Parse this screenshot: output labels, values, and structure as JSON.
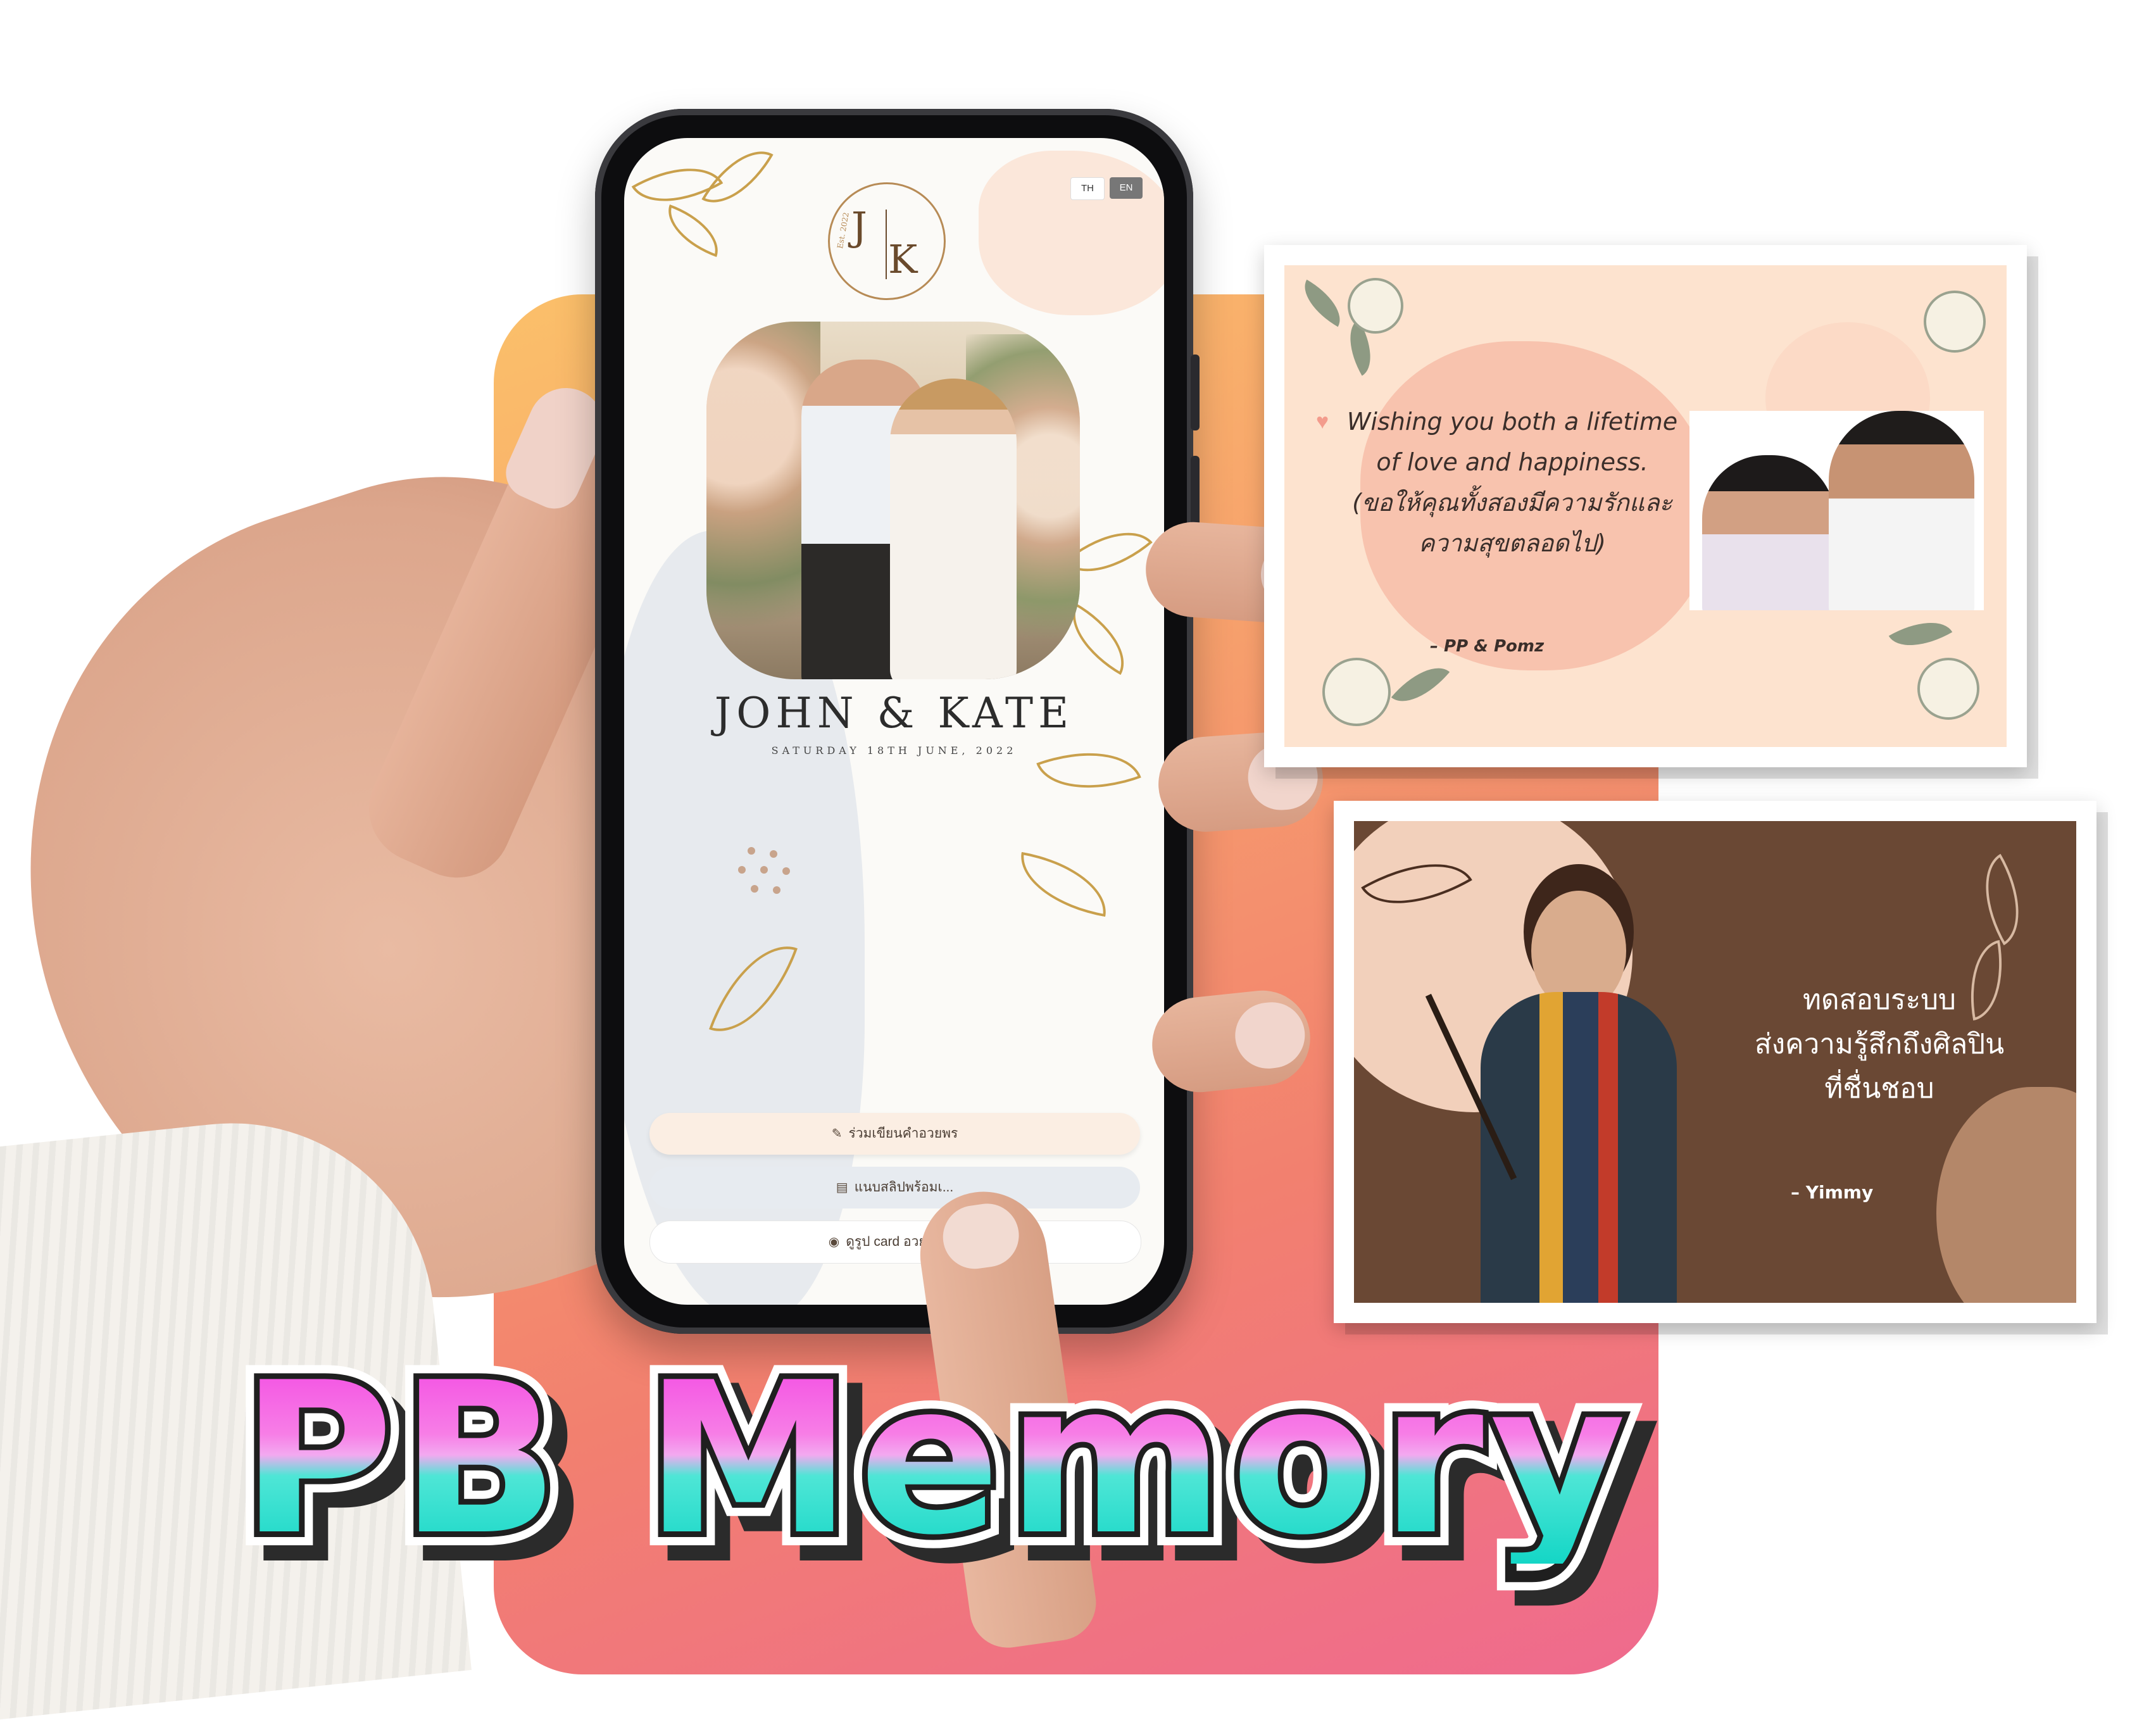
{
  "phone": {
    "lang_th": "TH",
    "lang_en": "EN",
    "monogram_j": "J",
    "monogram_k": "K",
    "monogram_est": "Est. 2022",
    "couple_names": "JOHN & KATE",
    "wedding_date": "SATURDAY 18TH JUNE, 2022",
    "buttons": [
      {
        "label": "ร่วมเขียนคำอวยพร",
        "icon": "pen-icon"
      },
      {
        "label": "แนบสลิปพร้อมเ...",
        "icon": "receipt-icon"
      },
      {
        "label": "ดูรูป card อวยพรทั้...",
        "icon": "eye-icon"
      }
    ]
  },
  "card_english": {
    "message": "Wishing you both a lifetime of love and happiness.\n(ขอให้คุณทั้งสองมีความรักและความสุขตลอดไป)",
    "signature": "– PP & Pomz"
  },
  "card_thai": {
    "message": "ทดสอบระบบ\nส่งความรู้สึกถึงศิลปิน\nที่ชื่นชอบ",
    "signature": "– Yimmy"
  },
  "brand": {
    "title": "PB Memory",
    "colors": {
      "gradient_top": "#f34ae3",
      "gradient_bottom": "#14d6c6",
      "outline": "#1f1f1f"
    }
  },
  "background": {
    "panel_gradient": [
      "#fbc06a",
      "#f2806f",
      "#ef6a8e"
    ]
  }
}
